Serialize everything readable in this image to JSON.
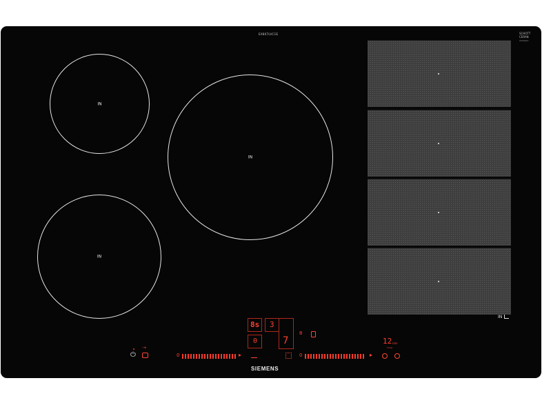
{
  "model": "EX807LVC1E",
  "schott": {
    "line1": "SCHOTT",
    "line2": "CERAN",
    "sub": "0000000"
  },
  "zones": {
    "label": "IN"
  },
  "flex_zone": {
    "label": "IN",
    "pads": 4
  },
  "controls": {
    "power_symbol": "⏻",
    "hint_symbol": "⇢",
    "timer_display": "8s",
    "zone_digit_top": "3",
    "zone_digit_mid": "0",
    "zone_digit_right": "7",
    "small_bars": "8",
    "min_timer": "12",
    "min_unit": "min",
    "min_sub": "Timer",
    "left_slider_start": "0",
    "left_slider_end": "▸",
    "right_slider_start": "0",
    "right_slider_end": "▸"
  },
  "brand": "SIEMENS",
  "colors": {
    "glass": "#060606",
    "flex": "#3e3e3e",
    "touch_red": "#ff3b2b",
    "ring": "#e7e7e7"
  }
}
